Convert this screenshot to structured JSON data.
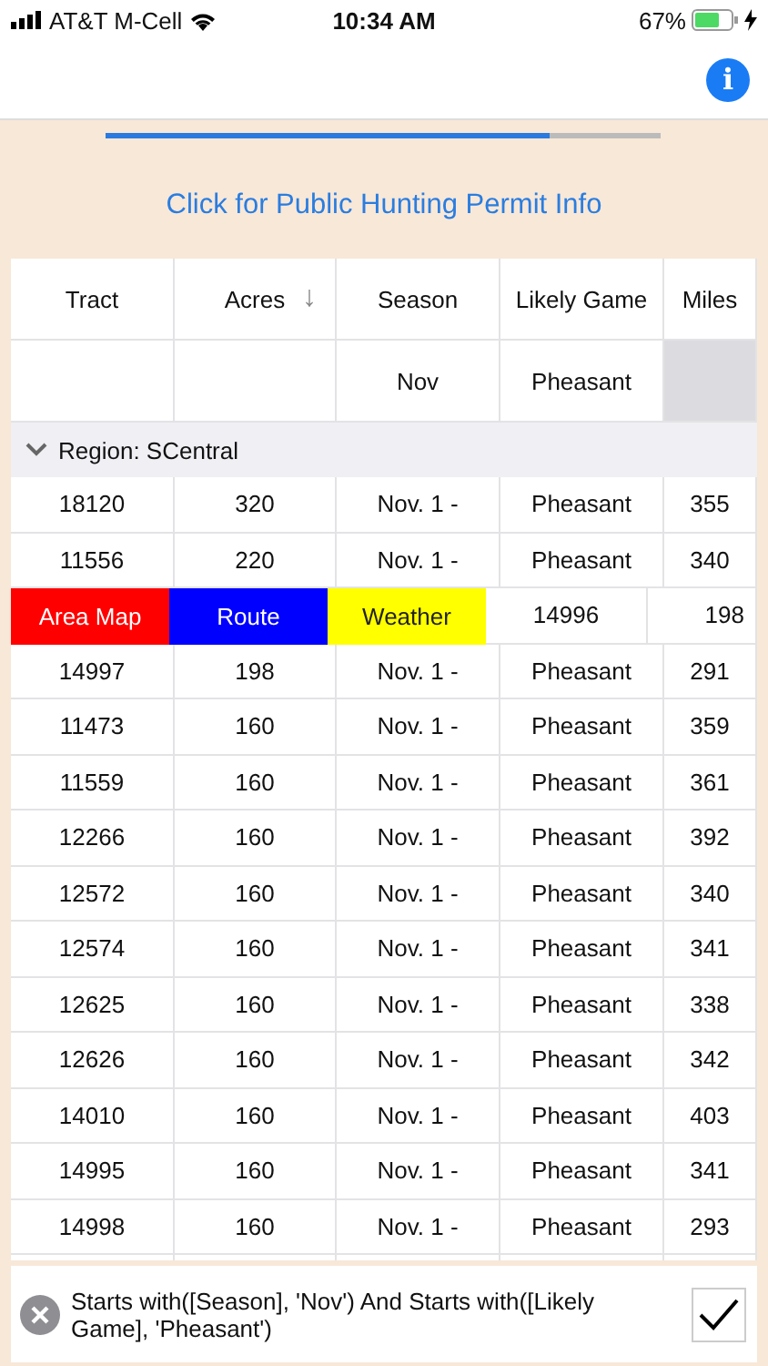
{
  "status_bar": {
    "carrier": "AT&T M-Cell",
    "time": "10:34 AM",
    "battery_percent": "67%"
  },
  "nav_bar": {
    "info_button": "i"
  },
  "progress": {
    "level": 0.8
  },
  "permit_link": "Click for Public Hunting Permit Info",
  "table": {
    "columns": [
      {
        "label": "Tract"
      },
      {
        "label": "Acres",
        "sort_arrow": "↓"
      },
      {
        "label": "Season"
      },
      {
        "label": "Likely Game"
      },
      {
        "label": "Miles"
      }
    ],
    "filters": [
      {
        "disabled": false
      },
      {
        "disabled": false
      },
      {
        "value": "Nov",
        "disabled": false
      },
      {
        "value": "Pheasant",
        "disabled": false
      },
      {
        "disabled": true
      }
    ],
    "group": {
      "label": "Region: SCentral",
      "expanded": true
    },
    "rows": [
      {
        "kind": "data",
        "cells": [
          "18120",
          "320",
          "Nov. 1 -",
          "Pheasant",
          "355"
        ]
      },
      {
        "kind": "data",
        "cells": [
          "11556",
          "220",
          "Nov. 1 -",
          "Pheasant",
          "340"
        ]
      },
      {
        "kind": "swiped",
        "actions": [
          {
            "label": "Area Map",
            "color": "#ff0000"
          },
          {
            "label": "Route",
            "color": "#0000ff"
          },
          {
            "label": "Weather",
            "color": "#ffff00"
          }
        ],
        "slid_tract": "14996",
        "slid_acres": "198"
      },
      {
        "kind": "data",
        "cells": [
          "14997",
          "198",
          "Nov. 1 -",
          "Pheasant",
          "291"
        ]
      },
      {
        "kind": "data",
        "cells": [
          "11473",
          "160",
          "Nov. 1 -",
          "Pheasant",
          "359"
        ]
      },
      {
        "kind": "data",
        "cells": [
          "11559",
          "160",
          "Nov. 1 -",
          "Pheasant",
          "361"
        ]
      },
      {
        "kind": "data",
        "cells": [
          "12266",
          "160",
          "Nov. 1 -",
          "Pheasant",
          "392"
        ]
      },
      {
        "kind": "data",
        "cells": [
          "12572",
          "160",
          "Nov. 1 -",
          "Pheasant",
          "340"
        ]
      },
      {
        "kind": "data",
        "cells": [
          "12574",
          "160",
          "Nov. 1 -",
          "Pheasant",
          "341"
        ]
      },
      {
        "kind": "data",
        "cells": [
          "12625",
          "160",
          "Nov. 1 -",
          "Pheasant",
          "338"
        ]
      },
      {
        "kind": "data",
        "cells": [
          "12626",
          "160",
          "Nov. 1 -",
          "Pheasant",
          "342"
        ]
      },
      {
        "kind": "data",
        "cells": [
          "14010",
          "160",
          "Nov. 1 -",
          "Pheasant",
          "403"
        ]
      },
      {
        "kind": "data",
        "cells": [
          "14995",
          "160",
          "Nov. 1 -",
          "Pheasant",
          "341"
        ]
      },
      {
        "kind": "data",
        "cells": [
          "14998",
          "160",
          "Nov. 1 -",
          "Pheasant",
          "293"
        ]
      }
    ]
  },
  "filter_bar": {
    "expression": "Starts with([Season], 'Nov') And Starts with([Likely Game], 'Pheasant')"
  }
}
